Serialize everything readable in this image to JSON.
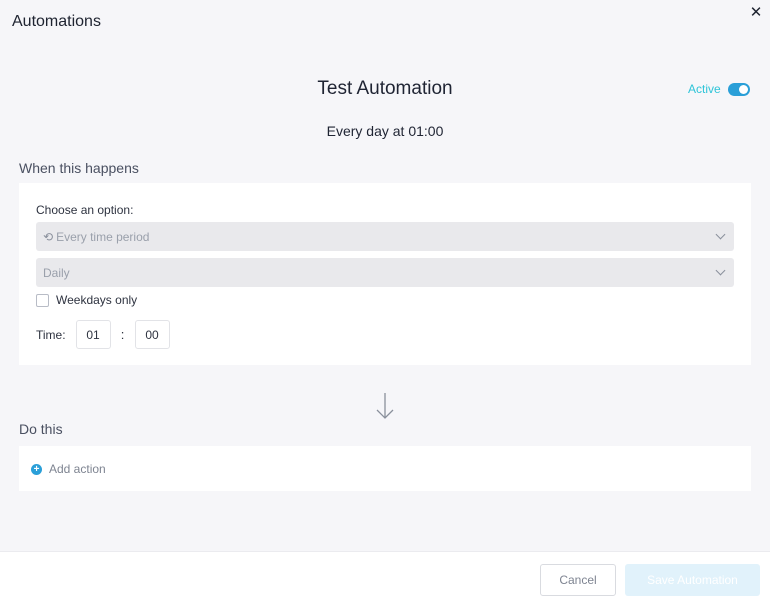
{
  "header": {
    "title": "Automations",
    "close_glyph": "✕"
  },
  "automation": {
    "title": "Test Automation",
    "status_label": "Active",
    "status_on": true,
    "schedule_summary": "Every day at 01:00"
  },
  "trigger": {
    "section_label": "When this happens",
    "choose_label": "Choose an option:",
    "trigger_type": {
      "icon": "history-icon",
      "glyph": "⟲",
      "value": "Every time period"
    },
    "period": {
      "value": "Daily"
    },
    "weekdays_only": {
      "label": "Weekdays only",
      "checked": false
    },
    "time": {
      "label": "Time:",
      "hours": "01",
      "separator": ":",
      "minutes": "00"
    }
  },
  "action": {
    "section_label": "Do this",
    "add_action_label": "Add action",
    "add_glyph": "+"
  },
  "footer": {
    "cancel_label": "Cancel",
    "save_label": "Save Automation"
  },
  "colors": {
    "accent": "#2a9fd8",
    "active_text": "#2ec4d8",
    "save_disabled_bg": "#e1f2fb"
  }
}
